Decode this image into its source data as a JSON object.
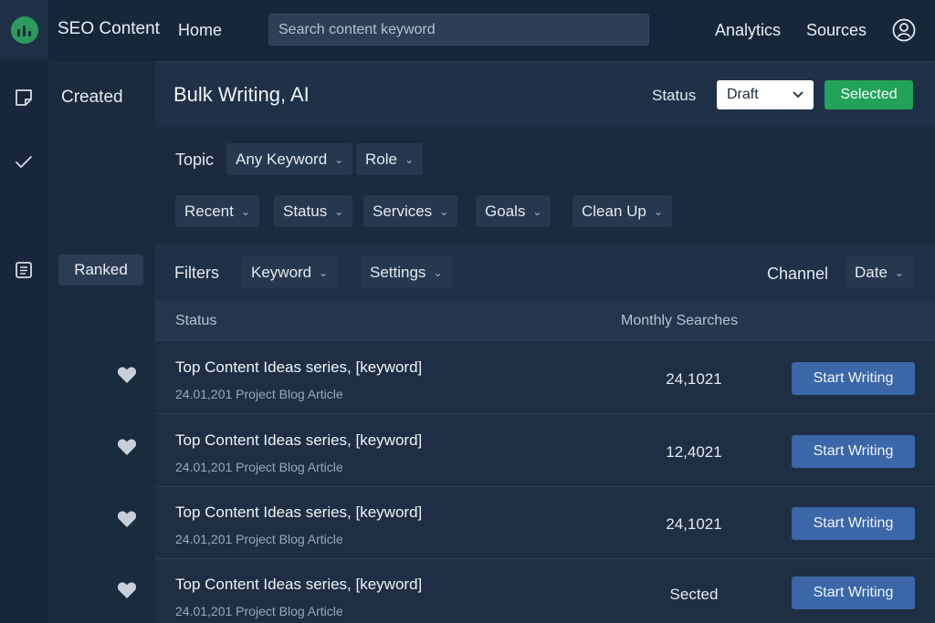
{
  "app": {
    "title": "SEO Content"
  },
  "nav": {
    "home": "Home",
    "analytics": "Analytics",
    "sources": "Sources"
  },
  "search": {
    "placeholder": "Search content keyword"
  },
  "sidebar": {
    "created": "Created",
    "ranked": "Ranked"
  },
  "header": {
    "title": "Bulk Writing, AI",
    "status_label": "Status",
    "status_value": "Draft",
    "selected_button": "Selected"
  },
  "topic": {
    "label": "Topic",
    "keyword_dropdown": "Any Keyword",
    "role_dropdown": "Role"
  },
  "filter_chips": [
    "Recent",
    "Status",
    "Services",
    "Goals",
    "Clean Up"
  ],
  "filterbar": {
    "label": "Filters",
    "keyword": "Keyword",
    "settings": "Settings",
    "channel_label": "Channel",
    "date": "Date"
  },
  "table": {
    "columns": {
      "status": "Status",
      "monthly": "Monthly Searches"
    },
    "action_label": "Start Writing",
    "rows": [
      {
        "title": "Top Content Ideas series, [keyword]",
        "subtitle": "24.01,201 Project Blog Article",
        "value": "24,1021"
      },
      {
        "title": "Top Content Ideas series, [keyword]",
        "subtitle": "24.01,201 Project Blog Article",
        "value": "12,4021"
      },
      {
        "title": "Top Content Ideas series, [keyword]",
        "subtitle": "24.01,201 Project Blog Article",
        "value": "24,1021"
      },
      {
        "title": "Top Content Ideas series, [keyword]",
        "subtitle": "24.01,201 Project Blog Article",
        "value": "Sected"
      }
    ]
  },
  "colors": {
    "accent_green": "#22a35a",
    "button_blue": "#3b66a8",
    "background": "#1b2a3d"
  },
  "icons": [
    "logo-icon",
    "user-icon",
    "note-icon",
    "check-icon",
    "list-icon",
    "heart-icon",
    "chevron-down-icon"
  ]
}
